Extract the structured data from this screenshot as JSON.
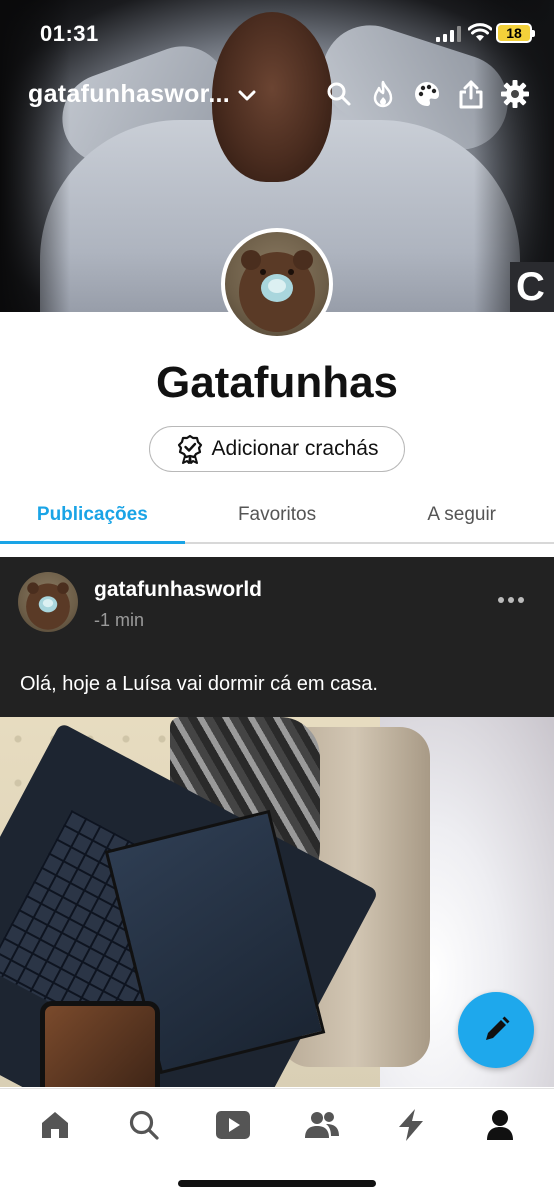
{
  "status_bar": {
    "time": "01:31",
    "battery": "18"
  },
  "header": {
    "blog_name": "gatafunhaswor...",
    "icons": [
      "search-icon",
      "flame-icon",
      "palette-icon",
      "share-icon",
      "gear-icon"
    ]
  },
  "profile": {
    "name": "Gatafunhas",
    "badge_button": "Adicionar crachás"
  },
  "tabs": [
    {
      "label": "Publicações",
      "active": true
    },
    {
      "label": "Favoritos",
      "active": false
    },
    {
      "label": "A seguir",
      "active": false
    }
  ],
  "post": {
    "username": "gatafunhasworld",
    "time": "-1 min",
    "text": "Olá, hoje a Luísa vai dormir cá em casa."
  },
  "bottom_nav": {
    "items": [
      "home-icon",
      "search-icon",
      "video-icon",
      "people-icon",
      "lightning-icon",
      "account-icon"
    ]
  },
  "colors": {
    "accent": "#1aa4e6",
    "fab": "#1ea8ec",
    "post_bg": "#222222",
    "battery": "#f3d13a"
  }
}
